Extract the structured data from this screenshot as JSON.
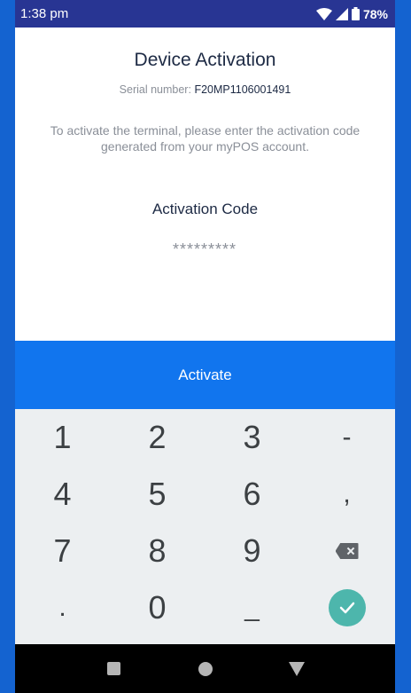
{
  "status_bar": {
    "time": "1:38 pm",
    "battery": "78%",
    "icons": [
      "wifi-icon",
      "signal-icon",
      "battery-icon"
    ]
  },
  "header": {
    "title": "Device Activation",
    "serial_label": "Serial number:",
    "serial_value": "F20MP1106001491"
  },
  "instructions": "To activate the terminal, please enter the activation code generated from your myPOS account.",
  "activation": {
    "label": "Activation Code",
    "placeholder": "*********"
  },
  "activate_button": "Activate",
  "keypad": {
    "rows": [
      [
        "1",
        "2",
        "3",
        "-"
      ],
      [
        "4",
        "5",
        "6",
        ","
      ],
      [
        "7",
        "8",
        "9",
        ""
      ],
      [
        ".",
        "0",
        "_",
        ""
      ]
    ],
    "icons": {
      "backspace": "backspace-icon",
      "done": "check-icon"
    }
  },
  "navigation": [
    "recents-icon",
    "home-icon",
    "back-icon"
  ],
  "colors": {
    "status_bar": "#283593",
    "frame": "#1463d0",
    "activate": "#1175ee",
    "keypad_bg": "#eceff1",
    "done_button": "#4db6ac"
  }
}
